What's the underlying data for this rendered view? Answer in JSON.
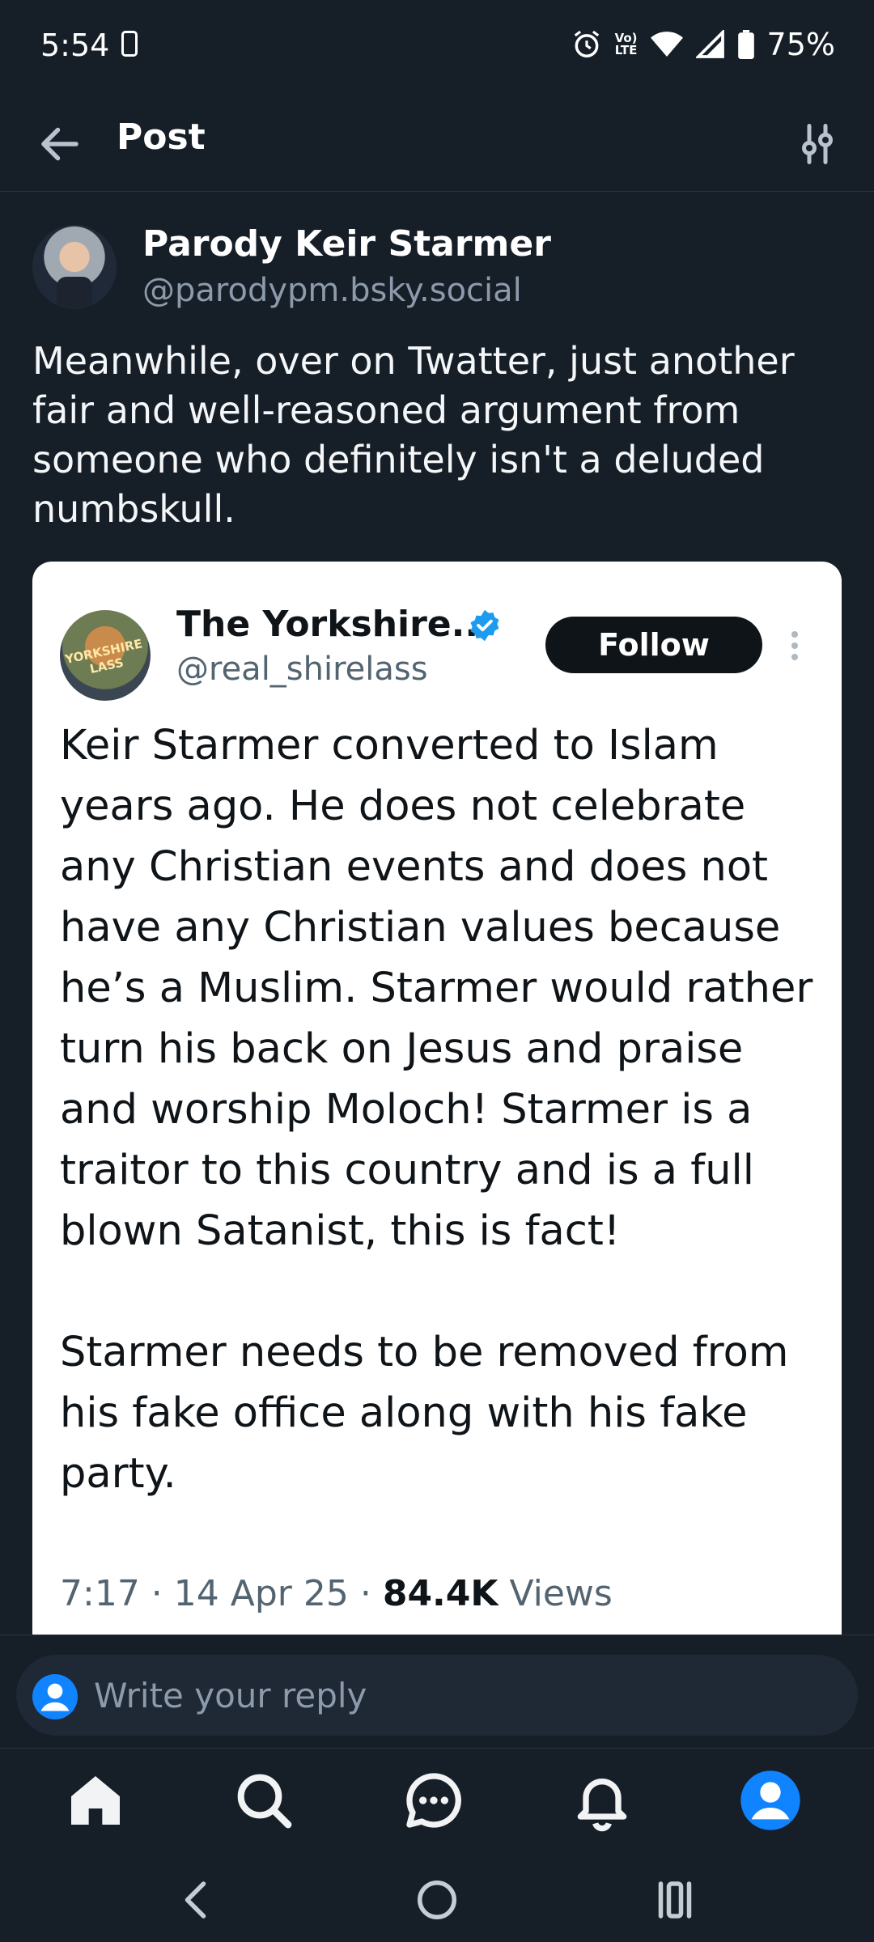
{
  "status_bar": {
    "time": "5:54",
    "battery": "75%",
    "network_label_top": "Vo)",
    "network_label_bottom": "LTE"
  },
  "header": {
    "title": "Post"
  },
  "post": {
    "author_name": "Parody Keir Starmer",
    "author_handle": "@parodypm.bsky.social",
    "text": "Meanwhile, over on Twatter, just another fair and well-reasoned argument from someone who definitely isn't a deluded numbskull."
  },
  "embedded_screenshot": {
    "author_name": "The Yorkshire...",
    "author_handle": "@real_shirelass",
    "avatar_text": "YORKSHIRE LASS",
    "follow_label": "Follow",
    "body": "Keir Starmer converted to Islam years ago. He does not celebrate any Christian events and does not have any Christian values because he’s a Muslim. Starmer would rather turn his back on Jesus and praise and worship Moloch! Starmer is a traitor to this country and is a full blown Satanist, this is fact!\n\nStarmer needs to be removed from his fake office along with his fake party.",
    "time": "7:17",
    "sep1": " · ",
    "date": "14 Apr 25",
    "sep2": " · ",
    "views_count": "84.4K",
    "views_label": " Views"
  },
  "reply": {
    "placeholder": "Write your reply"
  },
  "tabs": [
    "home-icon",
    "search-icon",
    "chat-icon",
    "notifications-icon",
    "profile-icon"
  ],
  "colors": {
    "background": "#161e27",
    "accent": "#1083fe",
    "verified": "#1d9bf0"
  }
}
